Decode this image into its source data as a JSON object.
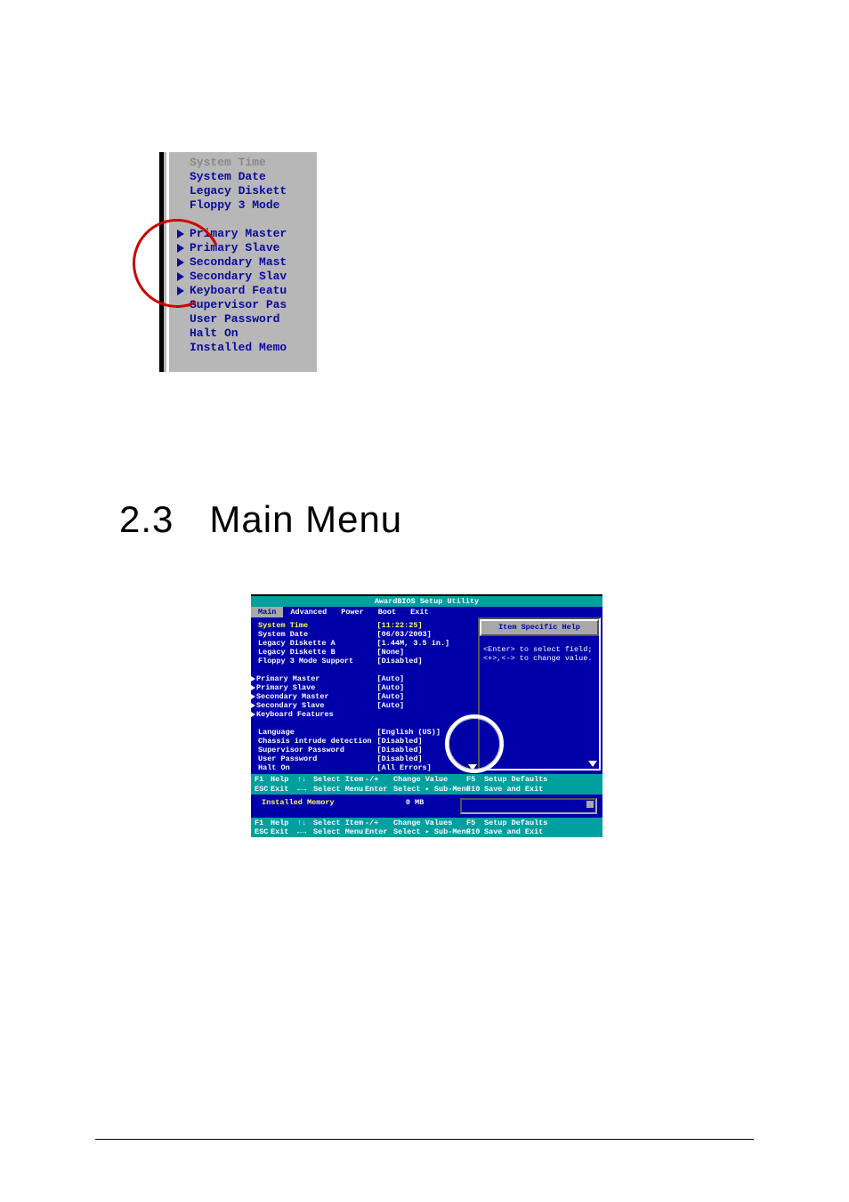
{
  "partial_bios": {
    "rows": [
      {
        "label": "System Time",
        "gray": true
      },
      {
        "label": "System Date"
      },
      {
        "label": "Legacy Diskett"
      },
      {
        "label": "Floppy 3 Mode"
      },
      {
        "label": "",
        "gap": true
      },
      {
        "label": "Primary Master",
        "tri": true
      },
      {
        "label": "Primary Slave",
        "tri": true
      },
      {
        "label": "Secondary Mast",
        "tri": true
      },
      {
        "label": "Secondary Slav",
        "tri": true
      },
      {
        "label": "Keyboard Featu",
        "tri": true
      },
      {
        "label": "Supervisor Pas"
      },
      {
        "label": "User Password"
      },
      {
        "label": "Halt On"
      },
      {
        "label": "Installed Memo"
      }
    ]
  },
  "heading": {
    "num": "2.3",
    "title": "Main Menu"
  },
  "bios": {
    "title": "AwardBIOS Setup Utility",
    "tabs": [
      "Main",
      "Advanced",
      "Power",
      "Boot",
      "Exit"
    ],
    "active_tab": 0,
    "items": [
      {
        "label": "System Time",
        "value": "[11:22:25]",
        "highlight_label": true,
        "highlight_val": true
      },
      {
        "label": "System Date",
        "value": "[06/03/2003]"
      },
      {
        "label": "Legacy Diskette A",
        "value": "[1.44M, 3.5 in.]"
      },
      {
        "label": "Legacy Diskette B",
        "value": "[None]"
      },
      {
        "label": "Floppy 3 Mode Support",
        "value": "[Disabled]"
      },
      {
        "gap": true
      },
      {
        "label": "Primary Master",
        "value": "[Auto]",
        "tri": true
      },
      {
        "label": "Primary Slave",
        "value": "[Auto]",
        "tri": true
      },
      {
        "label": "Secondary Master",
        "value": "[Auto]",
        "tri": true
      },
      {
        "label": "Secondary Slave",
        "value": "[Auto]",
        "tri": true
      },
      {
        "label": "Keyboard Features",
        "value": "",
        "tri": true
      },
      {
        "gap": true
      },
      {
        "label": "Language",
        "value": "[English (US)]"
      },
      {
        "label": "Chassis intrude detection",
        "value": "[Disabled]"
      },
      {
        "label": "Supervisor Password",
        "value": "[Disabled]"
      },
      {
        "label": "User Password",
        "value": "[Disabled]"
      },
      {
        "label": "Halt On",
        "value": "[All Errors]"
      }
    ],
    "help_title": "Item Specific Help",
    "help_text1": "<Enter> to select field;",
    "help_text2": "<+>,<-> to change value.",
    "mid_label": "Installed Memory",
    "mid_value": "0 MB",
    "footer1": {
      "c": [
        "F1",
        "Help",
        "↑↓",
        "Select Item",
        "-/+",
        "Change Value",
        "F5",
        "Setup Defaults",
        "ESC",
        "Exit",
        "←→",
        "Select Menu",
        "Enter",
        "Select ▸ Sub-Menu",
        "F10",
        "Save and Exit"
      ]
    },
    "footer2_suffix": "s"
  }
}
